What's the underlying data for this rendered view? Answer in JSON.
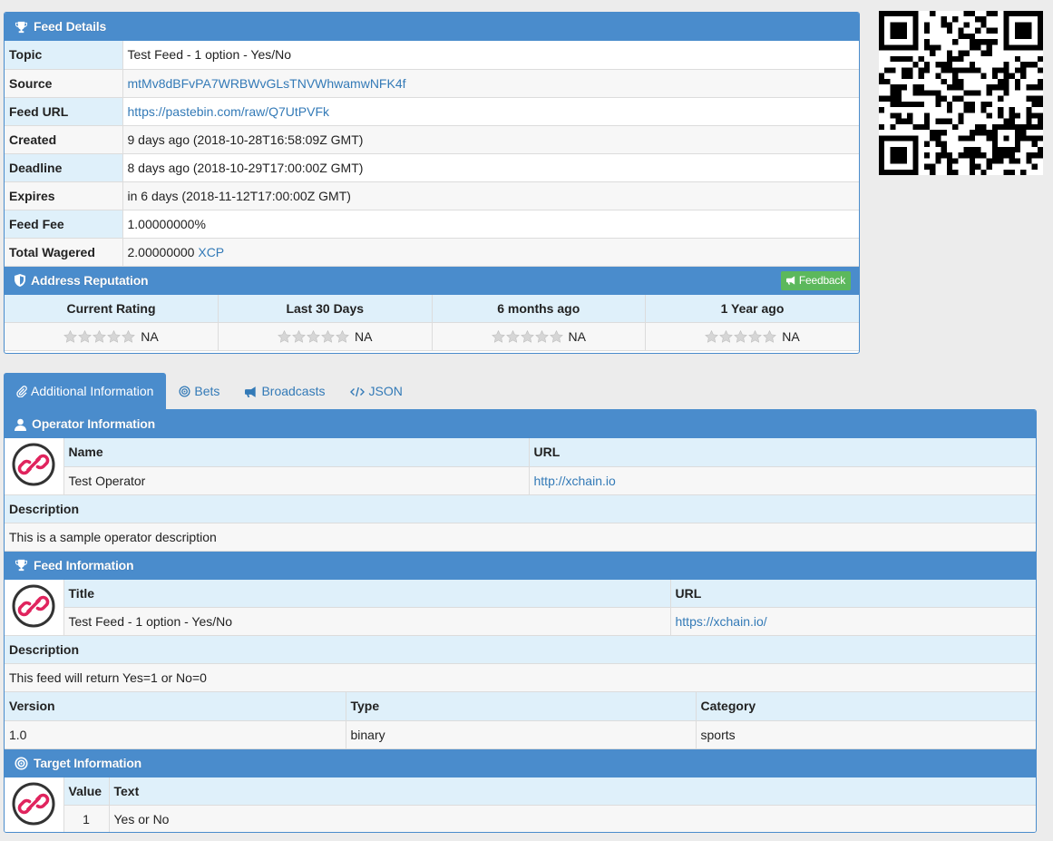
{
  "feed_details": {
    "title": "Feed Details",
    "rows": [
      {
        "label": "Topic",
        "value": "Test Feed - 1 option - Yes/No"
      },
      {
        "label": "Source",
        "value": "mtMv8dBFvPA7WRBWvGLsTNVWhwamwNFK4f"
      },
      {
        "label": "Feed URL",
        "value": "https://pastebin.com/raw/Q7UtPVFk"
      },
      {
        "label": "Created",
        "value": "9 days ago (2018-10-28T16:58:09Z GMT)"
      },
      {
        "label": "Deadline",
        "value": "8 days ago (2018-10-29T17:00:00Z GMT)"
      },
      {
        "label": "Expires",
        "value": "in 6 days (2018-11-12T17:00:00Z GMT)"
      },
      {
        "label": "Feed Fee",
        "value": "1.00000000%"
      },
      {
        "label": "Total Wagered",
        "value": "2.00000000",
        "unit": "XCP"
      }
    ]
  },
  "reputation": {
    "title": "Address Reputation",
    "feedback_label": "Feedback",
    "columns": [
      "Current Rating",
      "Last 30 Days",
      "6 months ago",
      "1 Year ago"
    ],
    "values": [
      "NA",
      "NA",
      "NA",
      "NA"
    ]
  },
  "tabs": [
    {
      "label": "Additional Information",
      "icon": "paperclip-icon"
    },
    {
      "label": "Bets",
      "icon": "target-icon"
    },
    {
      "label": "Broadcasts",
      "icon": "bullhorn-icon"
    },
    {
      "label": "JSON",
      "icon": "code-icon"
    }
  ],
  "operator": {
    "title": "Operator Information",
    "name_label": "Name",
    "url_label": "URL",
    "name": "Test Operator",
    "url": "http://xchain.io",
    "description_label": "Description",
    "description": "This is a sample operator description"
  },
  "feed_info": {
    "title": "Feed Information",
    "title_label": "Title",
    "url_label": "URL",
    "feed_title": "Test Feed - 1 option - Yes/No",
    "url": "https://xchain.io/",
    "description_label": "Description",
    "description": "This feed will return Yes=1 or No=0",
    "version_label": "Version",
    "type_label": "Type",
    "category_label": "Category",
    "version": "1.0",
    "type": "binary",
    "category": "sports"
  },
  "target": {
    "title": "Target Information",
    "value_label": "Value",
    "text_label": "Text",
    "value": "1",
    "text": "Yes or No"
  },
  "colors": {
    "panel_header": "#4a8ccc",
    "label_bg": "#dff0fa",
    "link": "#337ab7",
    "feedback_button": "#5cb85c",
    "logo_accent": "#e0245e"
  }
}
